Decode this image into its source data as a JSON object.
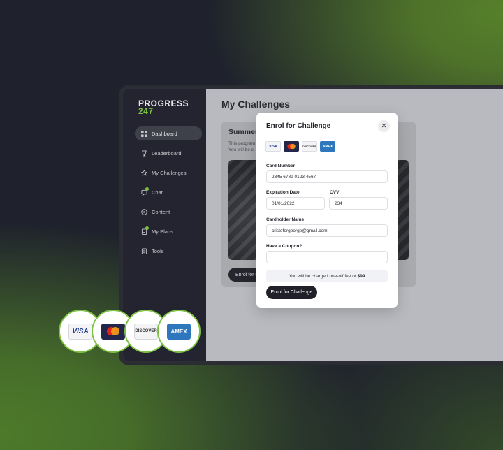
{
  "brand": {
    "line1": "PROGRESS",
    "line2": "247"
  },
  "sidebar": {
    "items": [
      {
        "label": "Dashboard",
        "icon": "grid-icon",
        "active": true
      },
      {
        "label": "Leaderboard",
        "icon": "trophy-icon"
      },
      {
        "label": "My Challenges",
        "icon": "star-icon"
      },
      {
        "label": "Chat",
        "icon": "chat-icon",
        "badge": true
      },
      {
        "label": "Content",
        "icon": "play-icon"
      },
      {
        "label": "My Plans",
        "icon": "plans-icon",
        "badge": true
      },
      {
        "label": "Tools",
        "icon": "tools-icon"
      }
    ]
  },
  "page": {
    "title": "My Challenges",
    "card": {
      "title": "Summer",
      "desc_line1": "This program",
      "desc_line2": "You will be c",
      "button_label": "Enrol for C"
    }
  },
  "modal": {
    "title": "Enrol for Challenge",
    "close_icon": "close-icon",
    "card_brands": [
      "VISA",
      "MasterCard",
      "DISCOVER",
      "AMEX"
    ],
    "card_number_label": "Card Number",
    "card_number_value": "2345 6789 0123 4567",
    "expiration_label": "Expiration Date",
    "expiration_value": "01/01/2022",
    "cvv_label": "CVV",
    "cvv_value": "234",
    "cardholder_label": "Cardholder Name",
    "cardholder_value": "cristofergeorge@gmail.com",
    "coupon_label": "Have a Coupon?",
    "coupon_value": "",
    "fee_text": "You will be charged one-off fee of",
    "fee_amount": "$99",
    "submit_label": "Enrol for Challenge"
  },
  "bubbles": [
    "VISA",
    "MasterCard",
    "DISCOVER",
    "AMEX"
  ],
  "colors": {
    "accent": "#7cc242",
    "dark": "#1f2028",
    "sidebar": "#23242f"
  }
}
